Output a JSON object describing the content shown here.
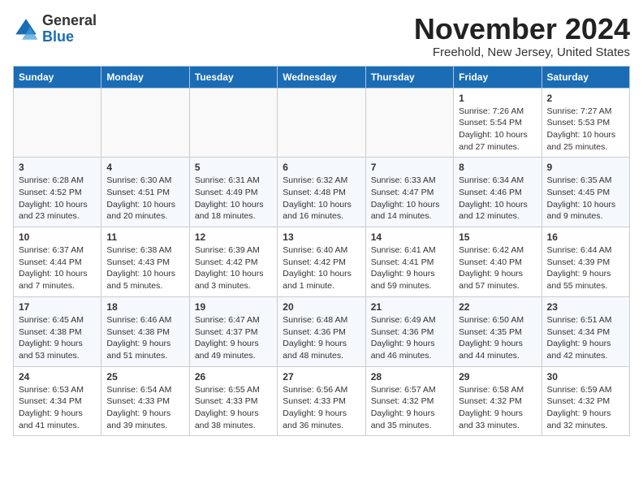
{
  "header": {
    "logo_general": "General",
    "logo_blue": "Blue",
    "month_title": "November 2024",
    "subtitle": "Freehold, New Jersey, United States"
  },
  "weekdays": [
    "Sunday",
    "Monday",
    "Tuesday",
    "Wednesday",
    "Thursday",
    "Friday",
    "Saturday"
  ],
  "weeks": [
    [
      {
        "day": "",
        "info": ""
      },
      {
        "day": "",
        "info": ""
      },
      {
        "day": "",
        "info": ""
      },
      {
        "day": "",
        "info": ""
      },
      {
        "day": "",
        "info": ""
      },
      {
        "day": "1",
        "info": "Sunrise: 7:26 AM\nSunset: 5:54 PM\nDaylight: 10 hours and 27 minutes."
      },
      {
        "day": "2",
        "info": "Sunrise: 7:27 AM\nSunset: 5:53 PM\nDaylight: 10 hours and 25 minutes."
      }
    ],
    [
      {
        "day": "3",
        "info": "Sunrise: 6:28 AM\nSunset: 4:52 PM\nDaylight: 10 hours and 23 minutes."
      },
      {
        "day": "4",
        "info": "Sunrise: 6:30 AM\nSunset: 4:51 PM\nDaylight: 10 hours and 20 minutes."
      },
      {
        "day": "5",
        "info": "Sunrise: 6:31 AM\nSunset: 4:49 PM\nDaylight: 10 hours and 18 minutes."
      },
      {
        "day": "6",
        "info": "Sunrise: 6:32 AM\nSunset: 4:48 PM\nDaylight: 10 hours and 16 minutes."
      },
      {
        "day": "7",
        "info": "Sunrise: 6:33 AM\nSunset: 4:47 PM\nDaylight: 10 hours and 14 minutes."
      },
      {
        "day": "8",
        "info": "Sunrise: 6:34 AM\nSunset: 4:46 PM\nDaylight: 10 hours and 12 minutes."
      },
      {
        "day": "9",
        "info": "Sunrise: 6:35 AM\nSunset: 4:45 PM\nDaylight: 10 hours and 9 minutes."
      }
    ],
    [
      {
        "day": "10",
        "info": "Sunrise: 6:37 AM\nSunset: 4:44 PM\nDaylight: 10 hours and 7 minutes."
      },
      {
        "day": "11",
        "info": "Sunrise: 6:38 AM\nSunset: 4:43 PM\nDaylight: 10 hours and 5 minutes."
      },
      {
        "day": "12",
        "info": "Sunrise: 6:39 AM\nSunset: 4:42 PM\nDaylight: 10 hours and 3 minutes."
      },
      {
        "day": "13",
        "info": "Sunrise: 6:40 AM\nSunset: 4:42 PM\nDaylight: 10 hours and 1 minute."
      },
      {
        "day": "14",
        "info": "Sunrise: 6:41 AM\nSunset: 4:41 PM\nDaylight: 9 hours and 59 minutes."
      },
      {
        "day": "15",
        "info": "Sunrise: 6:42 AM\nSunset: 4:40 PM\nDaylight: 9 hours and 57 minutes."
      },
      {
        "day": "16",
        "info": "Sunrise: 6:44 AM\nSunset: 4:39 PM\nDaylight: 9 hours and 55 minutes."
      }
    ],
    [
      {
        "day": "17",
        "info": "Sunrise: 6:45 AM\nSunset: 4:38 PM\nDaylight: 9 hours and 53 minutes."
      },
      {
        "day": "18",
        "info": "Sunrise: 6:46 AM\nSunset: 4:38 PM\nDaylight: 9 hours and 51 minutes."
      },
      {
        "day": "19",
        "info": "Sunrise: 6:47 AM\nSunset: 4:37 PM\nDaylight: 9 hours and 49 minutes."
      },
      {
        "day": "20",
        "info": "Sunrise: 6:48 AM\nSunset: 4:36 PM\nDaylight: 9 hours and 48 minutes."
      },
      {
        "day": "21",
        "info": "Sunrise: 6:49 AM\nSunset: 4:36 PM\nDaylight: 9 hours and 46 minutes."
      },
      {
        "day": "22",
        "info": "Sunrise: 6:50 AM\nSunset: 4:35 PM\nDaylight: 9 hours and 44 minutes."
      },
      {
        "day": "23",
        "info": "Sunrise: 6:51 AM\nSunset: 4:34 PM\nDaylight: 9 hours and 42 minutes."
      }
    ],
    [
      {
        "day": "24",
        "info": "Sunrise: 6:53 AM\nSunset: 4:34 PM\nDaylight: 9 hours and 41 minutes."
      },
      {
        "day": "25",
        "info": "Sunrise: 6:54 AM\nSunset: 4:33 PM\nDaylight: 9 hours and 39 minutes."
      },
      {
        "day": "26",
        "info": "Sunrise: 6:55 AM\nSunset: 4:33 PM\nDaylight: 9 hours and 38 minutes."
      },
      {
        "day": "27",
        "info": "Sunrise: 6:56 AM\nSunset: 4:33 PM\nDaylight: 9 hours and 36 minutes."
      },
      {
        "day": "28",
        "info": "Sunrise: 6:57 AM\nSunset: 4:32 PM\nDaylight: 9 hours and 35 minutes."
      },
      {
        "day": "29",
        "info": "Sunrise: 6:58 AM\nSunset: 4:32 PM\nDaylight: 9 hours and 33 minutes."
      },
      {
        "day": "30",
        "info": "Sunrise: 6:59 AM\nSunset: 4:32 PM\nDaylight: 9 hours and 32 minutes."
      }
    ]
  ]
}
